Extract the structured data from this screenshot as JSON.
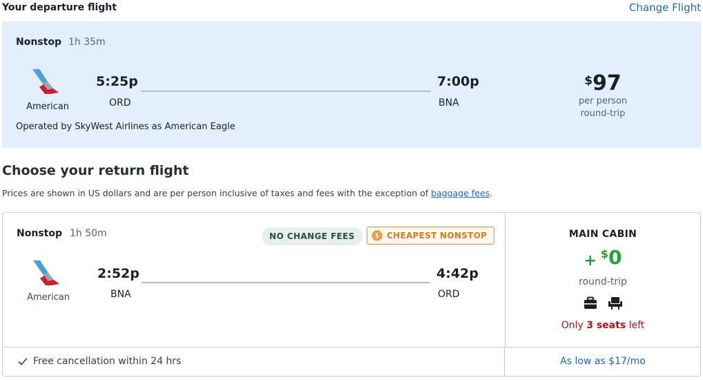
{
  "departure": {
    "section_title": "Your departure flight",
    "change_link": "Change Flight",
    "stops": "Nonstop",
    "duration": "1h 35m",
    "airline": "American",
    "depart_time": "5:25p",
    "depart_code": "ORD",
    "arrive_time": "7:00p",
    "arrive_code": "BNA",
    "operated_by": "Operated by SkyWest Airlines as American Eagle",
    "price_currency": "$",
    "price_amount": "97",
    "price_sub1": "per person",
    "price_sub2": "round-trip"
  },
  "return": {
    "section_title": "Choose your return flight",
    "disclaimer_text": "Prices are shown in US dollars and are per person inclusive of taxes and fees with the exception of ",
    "disclaimer_link": "baggage fees",
    "disclaimer_end": ".",
    "flight": {
      "stops": "Nonstop",
      "duration": "1h 50m",
      "badge_no_change": "NO CHANGE FEES",
      "badge_cheapest": "CHEAPEST NONSTOP",
      "airline": "American",
      "depart_time": "2:52p",
      "depart_code": "BNA",
      "arrive_time": "4:42p",
      "arrive_code": "ORD",
      "cabin_title": "MAIN CABIN",
      "cabin_plus": "+",
      "cabin_currency": "$",
      "cabin_amount": "0",
      "cabin_sub": "round-trip",
      "seats_prefix": "Only ",
      "seats_count": "3 seats",
      "seats_suffix": " left",
      "free_cancel": "Free cancellation within 24 hrs",
      "as_low_as": "As low as $17/mo",
      "amenity_icons": [
        "carry-on-bag-icon",
        "seat-icon"
      ]
    }
  },
  "colors": {
    "link": "#1e66c2",
    "departure_bg": "#e3effd",
    "price_green": "#20a33a",
    "seats_red": "#b3141b",
    "cheapest_orange": "#e07a1e"
  }
}
